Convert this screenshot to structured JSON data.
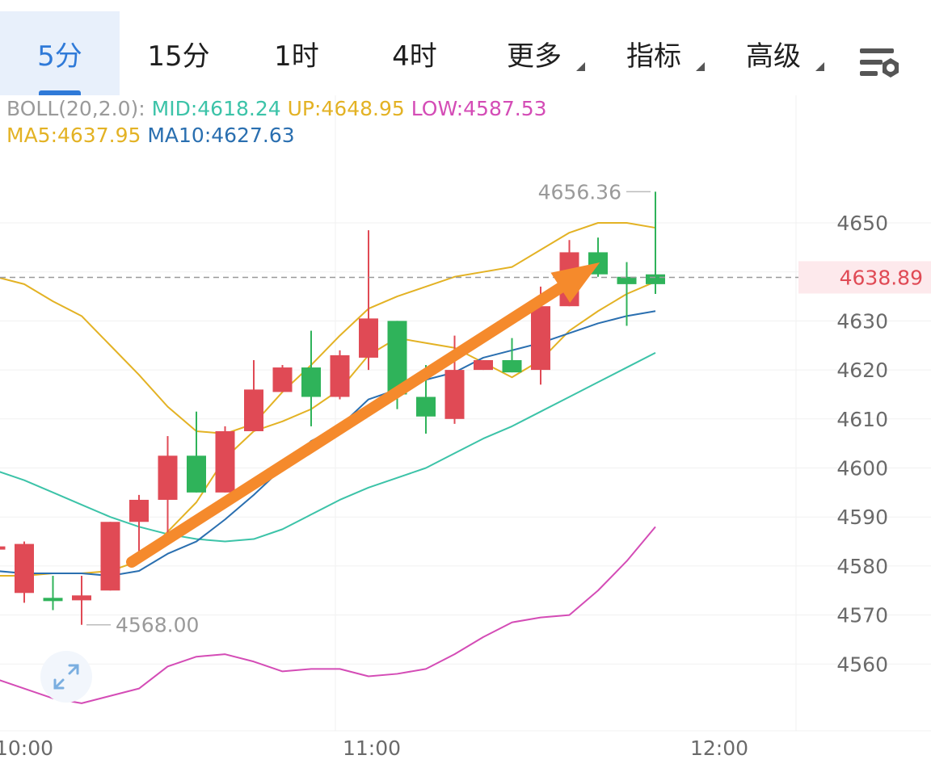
{
  "tabs": [
    {
      "label": "5分",
      "active": true,
      "dropdown": false
    },
    {
      "label": "15分",
      "active": false,
      "dropdown": false
    },
    {
      "label": "1时",
      "active": false,
      "dropdown": false
    },
    {
      "label": "4时",
      "active": false,
      "dropdown": false
    },
    {
      "label": "更多",
      "active": false,
      "dropdown": true
    },
    {
      "label": "指标",
      "active": false,
      "dropdown": true
    },
    {
      "label": "高级",
      "active": false,
      "dropdown": true
    }
  ],
  "settings_icon": "chart-settings-icon",
  "expand_icon": "expand-arrows-icon",
  "legend": {
    "boll_label": "BOLL(20,2.0):",
    "mid": "MID:4618.24",
    "up": "UP:4648.95",
    "low": "LOW:4587.53",
    "ma5": "MA5:4637.95",
    "ma10": "MA10:4627.63"
  },
  "colors": {
    "up_candle": "#e04a55",
    "down_candle": "#2fb35a",
    "mid": "#3cc3a8",
    "boll_band": "#e3b224",
    "low_band": "#d44cb6",
    "ma10": "#2a6fb0",
    "current_price_bg": "#fde9ec",
    "current_price_text": "#e04a55",
    "active_tab": "#2f7ad8",
    "trend_arrow": "#f58a2c"
  },
  "chart_data": {
    "type": "candlestick",
    "y_ticks": [
      4650,
      4640,
      4630,
      4620,
      4610,
      4600,
      4590,
      4580,
      4570,
      4560
    ],
    "y_tick_labels": [
      "4650",
      "4630",
      "4620",
      "4610",
      "4600",
      "4590",
      "4580",
      "4570",
      "4560"
    ],
    "x_ticks": [
      "10:00",
      "11:00",
      "12:00"
    ],
    "current_price": "4638.89",
    "high_label": "4656.36",
    "low_label": "4568.00",
    "candles": [
      {
        "o": 4584.0,
        "c": 4584.0,
        "h": 4584.0,
        "l": 4584.0
      },
      {
        "o": 4574.5,
        "c": 4584.5,
        "h": 4585.0,
        "l": 4572.5
      },
      {
        "o": 4573.5,
        "c": 4573.0,
        "h": 4578.0,
        "l": 4571.0
      },
      {
        "o": 4573.0,
        "c": 4574.0,
        "h": 4578.0,
        "l": 4568.0
      },
      {
        "o": 4575.0,
        "c": 4589.0,
        "h": 4589.0,
        "l": 4575.0
      },
      {
        "o": 4589.0,
        "c": 4593.5,
        "h": 4594.5,
        "l": 4583.0
      },
      {
        "o": 4593.5,
        "c": 4602.5,
        "h": 4606.5,
        "l": 4586.0
      },
      {
        "o": 4602.5,
        "c": 4595.0,
        "h": 4611.5,
        "l": 4595.0
      },
      {
        "o": 4595.0,
        "c": 4607.5,
        "h": 4608.5,
        "l": 4595.0
      },
      {
        "o": 4607.5,
        "c": 4616.0,
        "h": 4622.0,
        "l": 4607.5
      },
      {
        "o": 4615.5,
        "c": 4620.5,
        "h": 4621.0,
        "l": 4615.5
      },
      {
        "o": 4620.5,
        "c": 4614.5,
        "h": 4628.0,
        "l": 4608.5
      },
      {
        "o": 4614.5,
        "c": 4623.0,
        "h": 4624.0,
        "l": 4614.0
      },
      {
        "o": 4622.5,
        "c": 4630.5,
        "h": 4648.5,
        "l": 4620.0
      },
      {
        "o": 4630.0,
        "c": 4615.0,
        "h": 4630.0,
        "l": 4612.0
      },
      {
        "o": 4614.5,
        "c": 4610.5,
        "h": 4621.0,
        "l": 4607.0
      },
      {
        "o": 4610.0,
        "c": 4620.0,
        "h": 4627.0,
        "l": 4609.0
      },
      {
        "o": 4620.0,
        "c": 4622.0,
        "h": 4622.0,
        "l": 4620.0
      },
      {
        "o": 4622.0,
        "c": 4619.5,
        "h": 4626.5,
        "l": 4619.5
      },
      {
        "o": 4620.0,
        "c": 4633.0,
        "h": 4637.0,
        "l": 4617.0
      },
      {
        "o": 4633.0,
        "c": 4644.0,
        "h": 4646.5,
        "l": 4633.0
      },
      {
        "o": 4644.0,
        "c": 4639.5,
        "h": 4647.0,
        "l": 4639.0
      },
      {
        "o": 4639.0,
        "c": 4637.5,
        "h": 4642.0,
        "l": 4629.0
      },
      {
        "o": 4639.5,
        "c": 4637.5,
        "h": 4656.36,
        "l": 4635.5
      }
    ],
    "series": [
      {
        "name": "MID",
        "values": [
          4599.5,
          4597.5,
          4595,
          4592.5,
          4590,
          4588,
          4586.5,
          4585.5,
          4585,
          4585.5,
          4587.5,
          4590.5,
          4593.5,
          4596,
          4598,
          4600,
          4603,
          4606,
          4608.5,
          4611.5,
          4614.5,
          4617.5,
          4620.5,
          4623.5
        ]
      },
      {
        "name": "UP",
        "values": [
          4639,
          4637.5,
          4634,
          4631,
          4625,
          4619,
          4612.5,
          4607.5,
          4607,
          4609,
          4615.5,
          4621,
          4627,
          4632.5,
          4635,
          4637,
          4639,
          4640,
          4641,
          4644.5,
          4648,
          4650,
          4650,
          4649
        ]
      },
      {
        "name": "LOW",
        "values": [
          4557,
          4555,
          4553,
          4552,
          4553.5,
          4555,
          4559.5,
          4561.5,
          4562,
          4560.5,
          4558.5,
          4559,
          4559,
          4557.5,
          4558,
          4559,
          4562,
          4565.5,
          4568.5,
          4569.5,
          4570,
          4575,
          4581,
          4588
        ]
      },
      {
        "name": "MA5",
        "values": [
          4578,
          4578,
          4578.5,
          4578.5,
          4579,
          4581,
          4587,
          4593,
          4602,
          4607.5,
          4609.5,
          4612,
          4616,
          4623,
          4626.5,
          4625.5,
          4624.5,
          4621.5,
          4618.5,
          4622,
          4628,
          4632,
          4635.5,
          4638
        ]
      },
      {
        "name": "MA10",
        "values": [
          4579,
          4578.5,
          4578.5,
          4578.5,
          4578,
          4579,
          4582.5,
          4585,
          4589.5,
          4594.5,
          4600,
          4605.5,
          4608.5,
          4614,
          4616,
          4618,
          4619.5,
          4622.5,
          4624,
          4625.5,
          4627.5,
          4629.5,
          4631,
          4632
        ]
      }
    ]
  }
}
